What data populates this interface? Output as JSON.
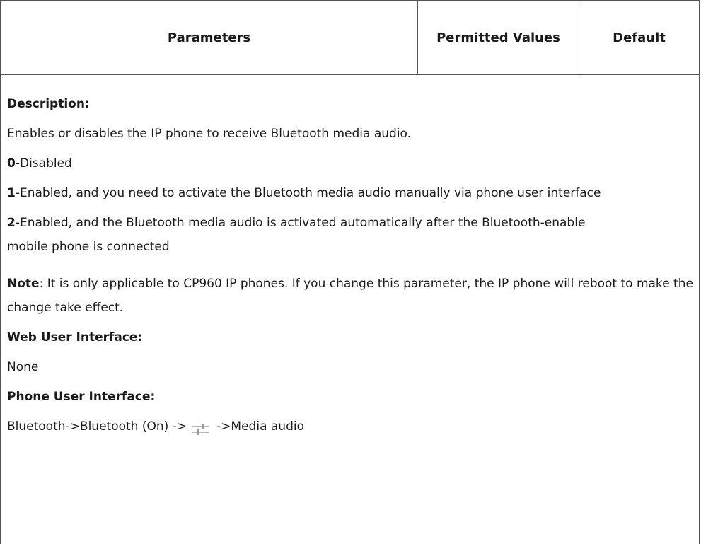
{
  "table": {
    "headers": {
      "parameters": "Parameters",
      "permitted_values": "Permitted Values",
      "default": "Default"
    },
    "description_label": "Description:",
    "description_text": "Enables or disables the IP phone to receive Bluetooth media audio.",
    "options": [
      {
        "value": "0",
        "text": "-Disabled"
      },
      {
        "value": "1",
        "text": "-Enabled, and you need to activate the Bluetooth media audio manually via phone user interface"
      },
      {
        "value": "2",
        "text": "-Enabled, and the Bluetooth media audio is activated automatically after the Bluetooth-enable mobile phone is connected"
      }
    ],
    "note_label": "Note",
    "note_text": ": It is only applicable to CP960 IP phones. If you change this parameter, the IP phone will reboot to make the change take effect.",
    "web_ui_label": "Web User Interface:",
    "web_ui_value": "None",
    "phone_ui_label": "Phone User Interface:",
    "phone_ui_path_before": "Bluetooth->Bluetooth (On) ->",
    "phone_ui_icon": "settings-sliders-icon",
    "phone_ui_path_after": "->Media audio"
  }
}
